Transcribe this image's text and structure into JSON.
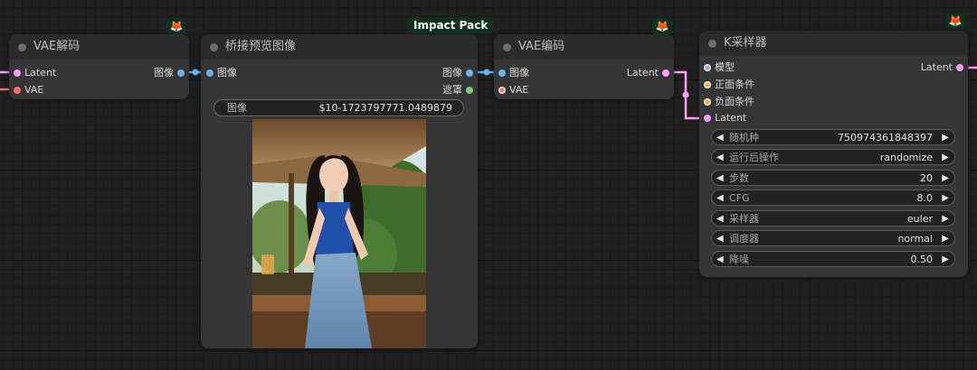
{
  "nodes": {
    "vae_decode": {
      "title": "VAE解码",
      "inputs": [
        "Latent",
        "VAE"
      ],
      "output": "图像"
    },
    "bridge_preview": {
      "title": "桥接预览图像",
      "input": "图像",
      "outputs": [
        "图像",
        "遮罩"
      ],
      "field_label": "图像",
      "field_value": "$10-1723797771.0489879",
      "badge": "Impact Pack"
    },
    "vae_encode": {
      "title": "VAE编码",
      "inputs": [
        "图像",
        "VAE"
      ],
      "output": "Latent"
    },
    "ksampler": {
      "title": "K采样器",
      "inputs": [
        "模型",
        "正面条件",
        "负面条件",
        "Latent"
      ],
      "output": "Latent",
      "widgets": [
        {
          "label": "随机种",
          "value": "750974361848397"
        },
        {
          "label": "运行后操作",
          "value": "randomize"
        },
        {
          "label": "步数",
          "value": "20"
        },
        {
          "label": "CFG",
          "value": "8.0"
        },
        {
          "label": "采样器",
          "value": "euler"
        },
        {
          "label": "调度器",
          "value": "normal"
        },
        {
          "label": "降噪",
          "value": "0.50"
        }
      ]
    }
  },
  "icons": {
    "badge_icon": "fox-icon",
    "arrow_left": "◀",
    "arrow_right": "▶"
  },
  "colors": {
    "latent": "#ff9cf9",
    "vae": "#ff6e6e",
    "image": "#64b5f6",
    "mask": "#81c784",
    "conditioning": "#ffa931",
    "model": "#b39ddb",
    "badge_bg": "#0f3121"
  }
}
